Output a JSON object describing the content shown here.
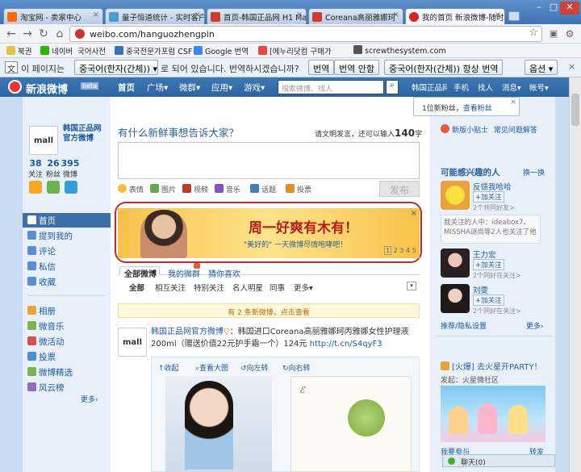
{
  "browser": {
    "tabs": [
      {
        "label": "淘宝网 - 卖家中心",
        "color": "#ff6a00"
      },
      {
        "label": "量子恒道统计 - 实时客户",
        "color": "#4a9ad8"
      },
      {
        "label": "首页-韩国正品网 H1 Ma",
        "color": "#d43a2a"
      },
      {
        "label": "Coreana高丽雅娜珂",
        "color": "#d43a2a"
      },
      {
        "label": "我的首页 新浪微博-随时",
        "color": "#d22"
      }
    ],
    "url": "weibo.com/hanguozhengpin",
    "bookmarks": [
      "북권",
      "네이버",
      "국어사전",
      "중국전문가포럼 CSF",
      "Google 번역",
      "[에누리닷컴 구매가",
      "screwthesystem.com"
    ]
  },
  "translate": {
    "prefix": "이 페이지는",
    "language": "중국어(한자(간체))",
    "suffix": "로 되어 있습니다. 번역하시겠습니까?",
    "translate_btn": "번역",
    "no_btn": "번역 안함",
    "always_btn": "중국어(한자(간체)) 항상 번역",
    "options_btn": "옵션"
  },
  "weibo": {
    "logo": "新浪微博",
    "beta": "beta",
    "nav": [
      "首页",
      "广场",
      "微群",
      "应用",
      "游戏"
    ],
    "search_placeholder": "搜索微博、找人",
    "right_nav": [
      "韩国正品网官...",
      "手机",
      "找人",
      "消息",
      "帐号"
    ],
    "toast": "1位新粉丝，",
    "toast_link": "查看粉丝",
    "profile": {
      "name": "韩国正品网官方微博",
      "logo": "mall",
      "following": "38",
      "followers": "26",
      "posts": "395",
      "following_label": "关注",
      "followers_label": "粉丝",
      "posts_label": "微博"
    },
    "left_menu": [
      "首页",
      "提到我的",
      "评论",
      "私信",
      "收藏"
    ],
    "left_menu2": [
      "相册",
      "微音乐",
      "微活动",
      "投票",
      "微博精选",
      "风云榜"
    ],
    "more": "更多›",
    "compose": {
      "prompt": "有什么新鲜事想告诉大家？",
      "hint": "请文明发言，还可以输入",
      "count": "140",
      "unit": "字",
      "tools": [
        "表情",
        "图片",
        "视频",
        "音乐",
        "话题",
        "投票"
      ],
      "submit": "发布"
    },
    "banner": {
      "text1": "周一好爽有木有！",
      "text2": "\"美好的\" 一天微博尽情咆哮吧！",
      "pages": [
        "1",
        "2",
        "3",
        "4",
        "5"
      ]
    },
    "tabs": [
      "全部微博",
      "我的微群",
      "猜你喜欢"
    ],
    "filters": [
      "全部",
      "相互关注",
      "特别关注",
      "名人明星",
      "同事",
      "更多"
    ],
    "new_notice": "有 2 条新微博，点击查看",
    "post": {
      "author": "韩国正品网官方微博",
      "text": "：韩国进口Coreana高丽雅娜珂丙雅娜女性护理液200ml（赠送价值22元护手霜一个）124元",
      "link": "http://t.cn/S4qyF3",
      "actions": [
        "收起",
        "查看大图",
        "向左转",
        "向右转"
      ]
    },
    "right": {
      "tips": [
        "新版小贴士",
        "常见问题解答"
      ],
      "interested": "可能感兴趣的人",
      "change": "换一换",
      "people": [
        {
          "name": "反馈我哈哈",
          "sub": "2个共同好友>"
        },
        {
          "name": "王力宏",
          "sub": "2个同好在关注>"
        },
        {
          "name": "刘雯",
          "sub": "2个同好在关注>"
        }
      ],
      "follow": "+加关注",
      "note": "我关注的人中：ideabox7、MISSHA谜尚等2人也关注了他",
      "recommend": "推荐/隐私设置",
      "event": "[火爆] 去火星开PARTY！",
      "event_from": "发起：火星微社区",
      "chat": "聊天(0)",
      "forward": "转发",
      "forward2": "我要参与"
    }
  }
}
